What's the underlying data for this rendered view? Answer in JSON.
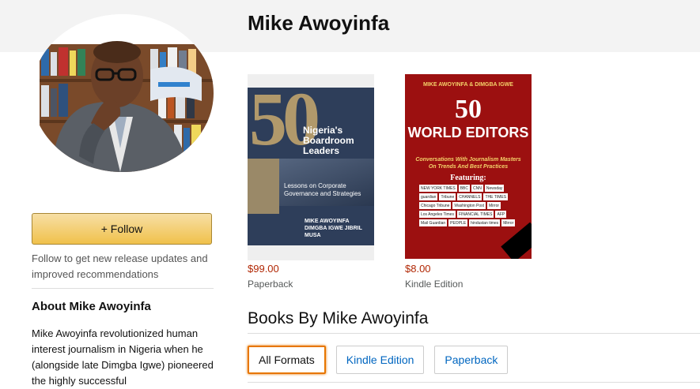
{
  "author": {
    "name": "Mike Awoyinfa"
  },
  "sidebar": {
    "follow_label": "+ Follow",
    "follow_note": "Follow to get new release updates and improved recommendations",
    "about_heading": "About Mike Awoyinfa",
    "about_text": "Mike Awoyinfa revolutionized human interest journalism in Nigeria when he (alongside late Dimgba Igwe) pioneered the highly successful"
  },
  "books": [
    {
      "cover_lines": {
        "number": "50",
        "title": "Nigeria's Boardroom Leaders",
        "subtitle": "Lessons on Corporate Governance and Strategies",
        "authors": "MIKE AWOYINFA DIMGBA IGWE JIBRIL MUSA"
      },
      "price": "$99.00",
      "format": "Paperback"
    },
    {
      "cover_lines": {
        "authors": "MIKE AWOYINFA & DIMGBA IGWE",
        "number": "50",
        "title": "WORLD EDITORS",
        "tagline": "Conversations With Journalism Masters On Trends And Best Practices",
        "featuring": "Featuring:",
        "logos": [
          "NEW YORK TIMES",
          "BBC",
          "CNN",
          "Newsday",
          "guardian",
          "Tribune",
          "CHANNELS",
          "THE TIMES",
          "Chicago Tribune",
          "Washington Post",
          "Mirror",
          "Los Angeles Times",
          "FINANCIAL TIMES",
          "AFP",
          "Mail Guardian",
          "PEOPLE",
          "hindustan times",
          "Mirror"
        ]
      },
      "price": "$8.00",
      "format": "Kindle Edition"
    }
  ],
  "section": {
    "title": "Books By Mike Awoyinfa",
    "tabs": [
      {
        "label": "All Formats",
        "active": true
      },
      {
        "label": "Kindle Edition",
        "active": false
      },
      {
        "label": "Paperback",
        "active": false
      }
    ]
  },
  "colors": {
    "accent": "#e77600",
    "price": "#b12704",
    "link": "#0066c0",
    "button": "#f0c14b"
  }
}
